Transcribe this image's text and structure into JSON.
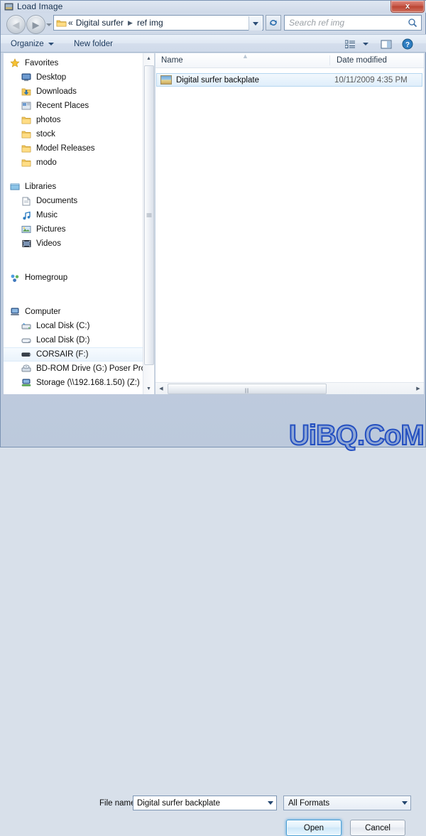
{
  "window": {
    "title": "Load Image",
    "title_icon": "app-image-icon",
    "close_label": "x"
  },
  "nav": {
    "back_label": "◀",
    "forward_label": "▶",
    "recent_dropdown": "chevron-down-icon",
    "refresh_label": "refresh-icon"
  },
  "address": {
    "folder_icon": "folder-icon",
    "overflow": "«",
    "segments": [
      "Digital surfer",
      "ref img"
    ],
    "separator": "▶",
    "dropdown": "chevron-down-icon"
  },
  "search": {
    "placeholder": "Search ref img",
    "icon": "search-icon"
  },
  "toolbar": {
    "organize_label": "Organize",
    "new_folder_label": "New folder",
    "view_icon": "view-list-icon",
    "view_caret": "chevron-down-icon",
    "preview_icon": "preview-pane-icon",
    "help_icon": "help-icon"
  },
  "sidebar": {
    "groups": [
      {
        "header": "Favorites",
        "header_icon": "star-icon",
        "items": [
          {
            "label": "Desktop",
            "icon": "desktop-icon"
          },
          {
            "label": "Downloads",
            "icon": "downloads-icon"
          },
          {
            "label": "Recent Places",
            "icon": "recent-places-icon"
          },
          {
            "label": "photos",
            "icon": "folder-icon"
          },
          {
            "label": "stock",
            "icon": "folder-icon"
          },
          {
            "label": "Model Releases",
            "icon": "folder-icon"
          },
          {
            "label": "modo",
            "icon": "folder-icon"
          }
        ]
      },
      {
        "header": "Libraries",
        "header_icon": "libraries-icon",
        "items": [
          {
            "label": "Documents",
            "icon": "document-icon"
          },
          {
            "label": "Music",
            "icon": "music-icon"
          },
          {
            "label": "Pictures",
            "icon": "pictures-icon"
          },
          {
            "label": "Videos",
            "icon": "videos-icon"
          }
        ]
      },
      {
        "header": "Homegroup",
        "header_icon": "homegroup-icon",
        "items": []
      },
      {
        "header": "Computer",
        "header_icon": "computer-icon",
        "items": [
          {
            "label": "Local Disk (C:)",
            "icon": "system-drive-icon"
          },
          {
            "label": "Local Disk (D:)",
            "icon": "drive-icon"
          },
          {
            "label": "CORSAIR (F:)",
            "icon": "usb-drive-icon",
            "hover": true
          },
          {
            "label": "BD-ROM Drive (G:) Poser Pro",
            "icon": "optical-drive-icon"
          },
          {
            "label": "Storage (\\\\192.168.1.50) (Z:)",
            "icon": "network-drive-icon"
          }
        ]
      }
    ],
    "scroll_up": "▲",
    "scroll_down": "▼"
  },
  "filelist": {
    "columns": [
      "Name",
      "Date modified"
    ],
    "sort_indicator": "▲",
    "rows": [
      {
        "name": "Digital surfer backplate",
        "date": "10/11/2009 4:35 PM",
        "icon": "image-thumbnail-icon",
        "selected": true
      }
    ],
    "hscroll_left": "◀",
    "hscroll_right": "▶"
  },
  "footer": {
    "filename_label": "File name:",
    "filename_value": "Digital surfer backplate",
    "filetype_value": "All Formats",
    "open_label": "Open",
    "cancel_label": "Cancel"
  },
  "watermark": {
    "text": "UiBQ.CoM"
  }
}
